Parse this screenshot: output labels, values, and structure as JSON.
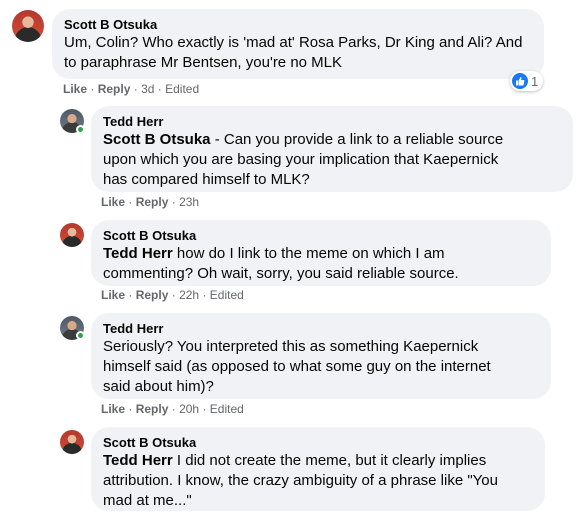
{
  "comments": [
    {
      "author": "Scott B Otsuka",
      "mention": "",
      "text_lines": [
        "Um, Colin? Who exactly is 'mad at' Rosa Parks, Dr King and Ali? And",
        "to paraphrase Mr Bentsen, you're no MLK"
      ],
      "like": "Like",
      "reply": "Reply",
      "time": "3d",
      "edited": "Edited",
      "reaction_count": "1"
    },
    {
      "author": "Tedd Herr",
      "mention": "Scott B Otsuka",
      "text_lines": [
        " - Can you provide a link to a reliable source",
        "upon which you are basing your implication that Kaepernick",
        "has compared himself to MLK?"
      ],
      "like": "Like",
      "reply": "Reply",
      "time": "23h",
      "edited": ""
    },
    {
      "author": "Scott B Otsuka",
      "mention": "Tedd Herr",
      "text_lines": [
        " how do I link to the meme on which I am",
        "commenting? Oh wait, sorry, you said reliable source."
      ],
      "like": "Like",
      "reply": "Reply",
      "time": "22h",
      "edited": "Edited"
    },
    {
      "author": "Tedd Herr",
      "mention": "",
      "text_lines": [
        "Seriously? You interpreted this as something Kaepernick",
        "himself said (as opposed to what some guy on the internet",
        "said about him)?"
      ],
      "like": "Like",
      "reply": "Reply",
      "time": "20h",
      "edited": "Edited"
    },
    {
      "author": "Scott B Otsuka",
      "mention": "Tedd Herr",
      "text_lines": [
        " I did not create the meme, but it clearly implies",
        "attribution. I know, the crazy ambiguity of a phrase like \"You",
        "mad at me...\""
      ],
      "like": "Like",
      "reply": "Reply",
      "time": "",
      "edited": ""
    }
  ],
  "sep": "·",
  "colors": {
    "bubble": "#f0f2f5",
    "like_blue": "#1877f2",
    "online": "#31a24c",
    "meta": "#65676b"
  }
}
